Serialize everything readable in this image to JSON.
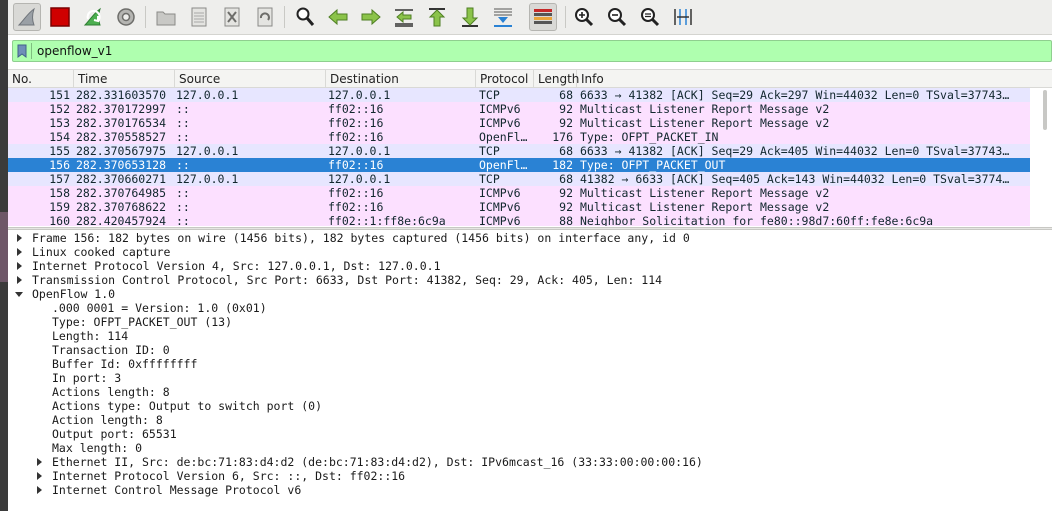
{
  "colors": {
    "filter_ok": "#afffaf",
    "tcp_row": "#e7e6ff",
    "icmp_row": "#fce0ff",
    "selected_row": "#2a82d4",
    "selected_text": "#ffffff"
  },
  "toolbar": {
    "buttons": [
      "shark-fin-icon",
      "stop-icon",
      "restart-capture-icon",
      "capture-options-icon",
      "open-file-icon",
      "save-file-icon",
      "close-file-icon",
      "reload-icon",
      "find-packet-icon",
      "go-back-icon",
      "go-forward-icon",
      "go-to-packet-icon",
      "first-packet-icon",
      "last-packet-icon",
      "autoscroll-icon",
      "colorize-icon",
      "zoom-in-icon",
      "zoom-out-icon",
      "zoom-normal-icon",
      "resize-columns-icon"
    ]
  },
  "filter": {
    "value": "openflow_v1"
  },
  "packet_list": {
    "columns": [
      "No.",
      "Time",
      "Source",
      "Destination",
      "Protocol",
      "Length",
      "Info"
    ],
    "rows": [
      {
        "no": "151",
        "time": "282.331603570",
        "src": "127.0.0.1",
        "dst": "127.0.0.1",
        "proto": "TCP",
        "len": "68",
        "info": "6633 → 41382 [ACK] Seq=29 Ack=297 Win=44032 Len=0 TSval=37743…",
        "kind": "tcp"
      },
      {
        "no": "152",
        "time": "282.370172997",
        "src": "::",
        "dst": "ff02::16",
        "proto": "ICMPv6",
        "len": "92",
        "info": "Multicast Listener Report Message v2",
        "kind": "icmp"
      },
      {
        "no": "153",
        "time": "282.370176534",
        "src": "::",
        "dst": "ff02::16",
        "proto": "ICMPv6",
        "len": "92",
        "info": "Multicast Listener Report Message v2",
        "kind": "icmp"
      },
      {
        "no": "154",
        "time": "282.370558527",
        "src": "::",
        "dst": "ff02::16",
        "proto": "OpenFl…",
        "len": "176",
        "info": "Type: OFPT_PACKET_IN",
        "kind": "icmp"
      },
      {
        "no": "155",
        "time": "282.370567975",
        "src": "127.0.0.1",
        "dst": "127.0.0.1",
        "proto": "TCP",
        "len": "68",
        "info": "6633 → 41382 [ACK] Seq=29 Ack=405 Win=44032 Len=0 TSval=37743…",
        "kind": "tcp"
      },
      {
        "no": "156",
        "time": "282.370653128",
        "src": "::",
        "dst": "ff02::16",
        "proto": "OpenFl…",
        "len": "182",
        "info": "Type: OFPT_PACKET_OUT",
        "kind": "selected"
      },
      {
        "no": "157",
        "time": "282.370660271",
        "src": "127.0.0.1",
        "dst": "127.0.0.1",
        "proto": "TCP",
        "len": "68",
        "info": "41382 → 6633 [ACK] Seq=405 Ack=143 Win=44032 Len=0 TSval=3774…",
        "kind": "tcp"
      },
      {
        "no": "158",
        "time": "282.370764985",
        "src": "::",
        "dst": "ff02::16",
        "proto": "ICMPv6",
        "len": "92",
        "info": "Multicast Listener Report Message v2",
        "kind": "icmp"
      },
      {
        "no": "159",
        "time": "282.370768622",
        "src": "::",
        "dst": "ff02::16",
        "proto": "ICMPv6",
        "len": "92",
        "info": "Multicast Listener Report Message v2",
        "kind": "icmp"
      },
      {
        "no": "160",
        "time": "282.420457924",
        "src": "::",
        "dst": "ff02::1:ff8e:6c9a",
        "proto": "ICMPv6",
        "len": "88",
        "info": "Neighbor Solicitation for fe80::98d7:60ff:fe8e:6c9a",
        "kind": "icmp"
      }
    ]
  },
  "details": {
    "lines": [
      {
        "text": "Frame 156: 182 bytes on wire (1456 bits), 182 bytes captured (1456 bits) on interface any, id 0",
        "level": 0,
        "arrow": "collapsed"
      },
      {
        "text": "Linux cooked capture",
        "level": 0,
        "arrow": "collapsed"
      },
      {
        "text": "Internet Protocol Version 4, Src: 127.0.0.1, Dst: 127.0.0.1",
        "level": 0,
        "arrow": "collapsed"
      },
      {
        "text": "Transmission Control Protocol, Src Port: 6633, Dst Port: 41382, Seq: 29, Ack: 405, Len: 114",
        "level": 0,
        "arrow": "collapsed"
      },
      {
        "text": "OpenFlow 1.0",
        "level": 0,
        "arrow": "expanded"
      },
      {
        "text": ".000 0001 = Version: 1.0 (0x01)",
        "level": 1,
        "arrow": "none"
      },
      {
        "text": "Type: OFPT_PACKET_OUT (13)",
        "level": 1,
        "arrow": "none"
      },
      {
        "text": "Length: 114",
        "level": 1,
        "arrow": "none"
      },
      {
        "text": "Transaction ID: 0",
        "level": 1,
        "arrow": "none"
      },
      {
        "text": "Buffer Id: 0xffffffff",
        "level": 1,
        "arrow": "none"
      },
      {
        "text": "In port: 3",
        "level": 1,
        "arrow": "none"
      },
      {
        "text": "Actions length: 8",
        "level": 1,
        "arrow": "none"
      },
      {
        "text": "Actions type: Output to switch port (0)",
        "level": 1,
        "arrow": "none"
      },
      {
        "text": "Action length: 8",
        "level": 1,
        "arrow": "none"
      },
      {
        "text": "Output port: 65531",
        "level": 1,
        "arrow": "none"
      },
      {
        "text": "Max length: 0",
        "level": 1,
        "arrow": "none"
      },
      {
        "text": "Ethernet II, Src: de:bc:71:83:d4:d2 (de:bc:71:83:d4:d2), Dst: IPv6mcast_16 (33:33:00:00:00:16)",
        "level": 1,
        "arrow": "collapsed"
      },
      {
        "text": "Internet Protocol Version 6, Src: ::, Dst: ff02::16",
        "level": 1,
        "arrow": "collapsed"
      },
      {
        "text": "Internet Control Message Protocol v6",
        "level": 1,
        "arrow": "collapsed"
      }
    ]
  }
}
